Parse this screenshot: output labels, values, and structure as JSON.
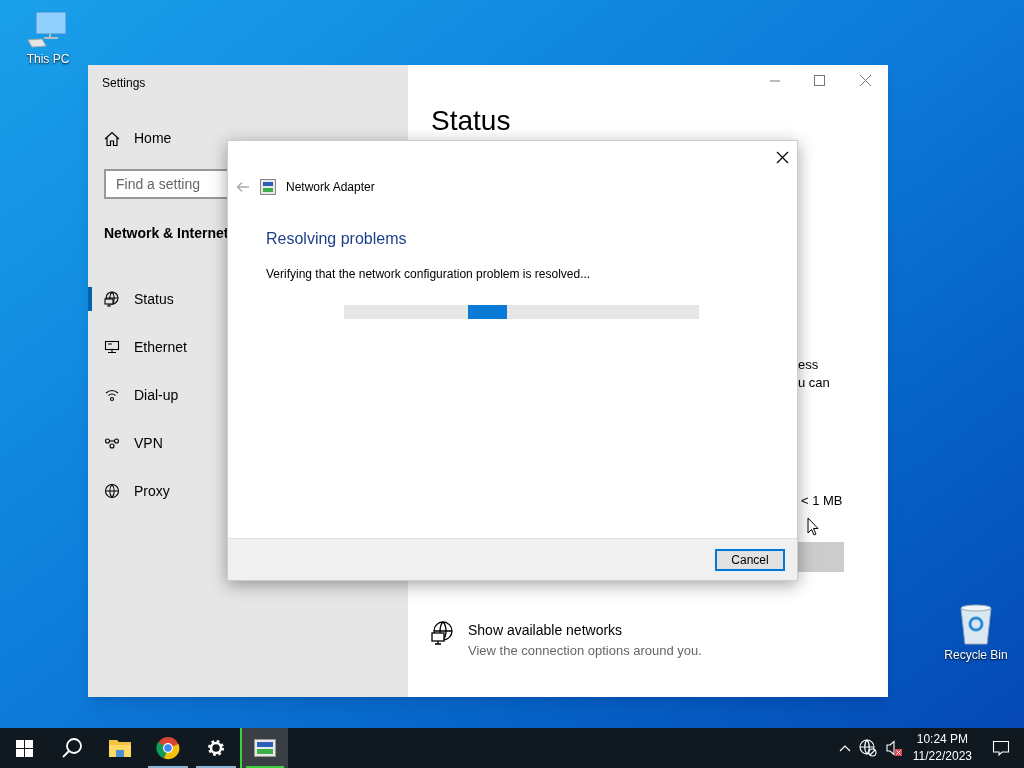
{
  "desktop_icons": [
    {
      "label": "This PC",
      "kind": "pc"
    },
    {
      "label": "Recycle Bin",
      "kind": "bin"
    }
  ],
  "settings": {
    "title": "Settings",
    "home": "Home",
    "search": {
      "placeholder": "Find a setting"
    },
    "section": "Network & Internet",
    "nav": [
      {
        "label": "Status",
        "kind": "status",
        "selected": true
      },
      {
        "label": "Ethernet",
        "kind": "ethernet",
        "selected": false
      },
      {
        "label": "Dial-up",
        "kind": "dialup",
        "selected": false
      },
      {
        "label": "VPN",
        "kind": "vpn",
        "selected": false
      },
      {
        "label": "Proxy",
        "kind": "proxy",
        "selected": false
      }
    ],
    "content": {
      "heading": "Status",
      "fragments": [
        "ess",
        "u can",
        "< 1 MB"
      ],
      "option": {
        "title": "Show available networks",
        "subtitle": "View the connection options around you."
      }
    }
  },
  "dialog": {
    "title": "Network Adapter",
    "heading": "Resolving problems",
    "message": "Verifying that the network configuration problem is resolved...",
    "buttons": [
      "Cancel"
    ]
  },
  "taskbar": {
    "apps": [
      {
        "kind": "start",
        "running": false,
        "active": false
      },
      {
        "kind": "search",
        "running": false,
        "active": false
      },
      {
        "kind": "folder",
        "running": false,
        "active": false
      },
      {
        "kind": "browser",
        "running": true,
        "active": false
      },
      {
        "kind": "settings",
        "running": true,
        "active": false
      },
      {
        "kind": "adapter",
        "running": true,
        "active": true
      }
    ],
    "clock": {
      "time": "10:24 PM",
      "date": "11/22/2023"
    }
  }
}
